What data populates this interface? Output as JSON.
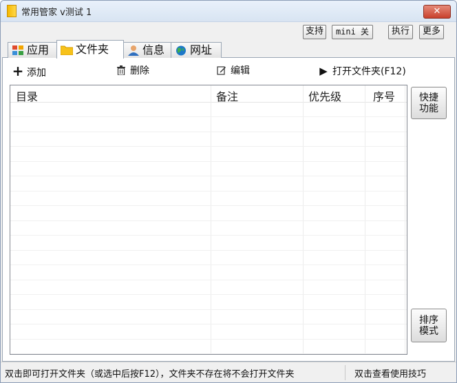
{
  "window": {
    "title": "常用管家 v测试 1",
    "close_label": "✕"
  },
  "top_buttons": {
    "support": "支持",
    "mini_close": "mini 关",
    "execute": "执行",
    "more": "更多"
  },
  "tabs": [
    {
      "label": "应用",
      "icon": "apps-icon"
    },
    {
      "label": "文件夹",
      "icon": "folder-icon",
      "active": true
    },
    {
      "label": "信息",
      "icon": "user-icon"
    },
    {
      "label": "网址",
      "icon": "globe-icon"
    }
  ],
  "toolbar": {
    "add": "添加",
    "delete": "删除",
    "edit": "编辑",
    "open_folder": "打开文件夹(F12)"
  },
  "table": {
    "columns": [
      "目录",
      "备注",
      "优先级",
      "序号"
    ],
    "rows": []
  },
  "side_buttons": {
    "quick_function": "快捷功能",
    "sort_mode": "排序模式"
  },
  "status": {
    "left": "双击即可打开文件夹（或选中后按F12），文件夹不存在将不会打开文件夹",
    "right": "双击查看使用技巧"
  }
}
